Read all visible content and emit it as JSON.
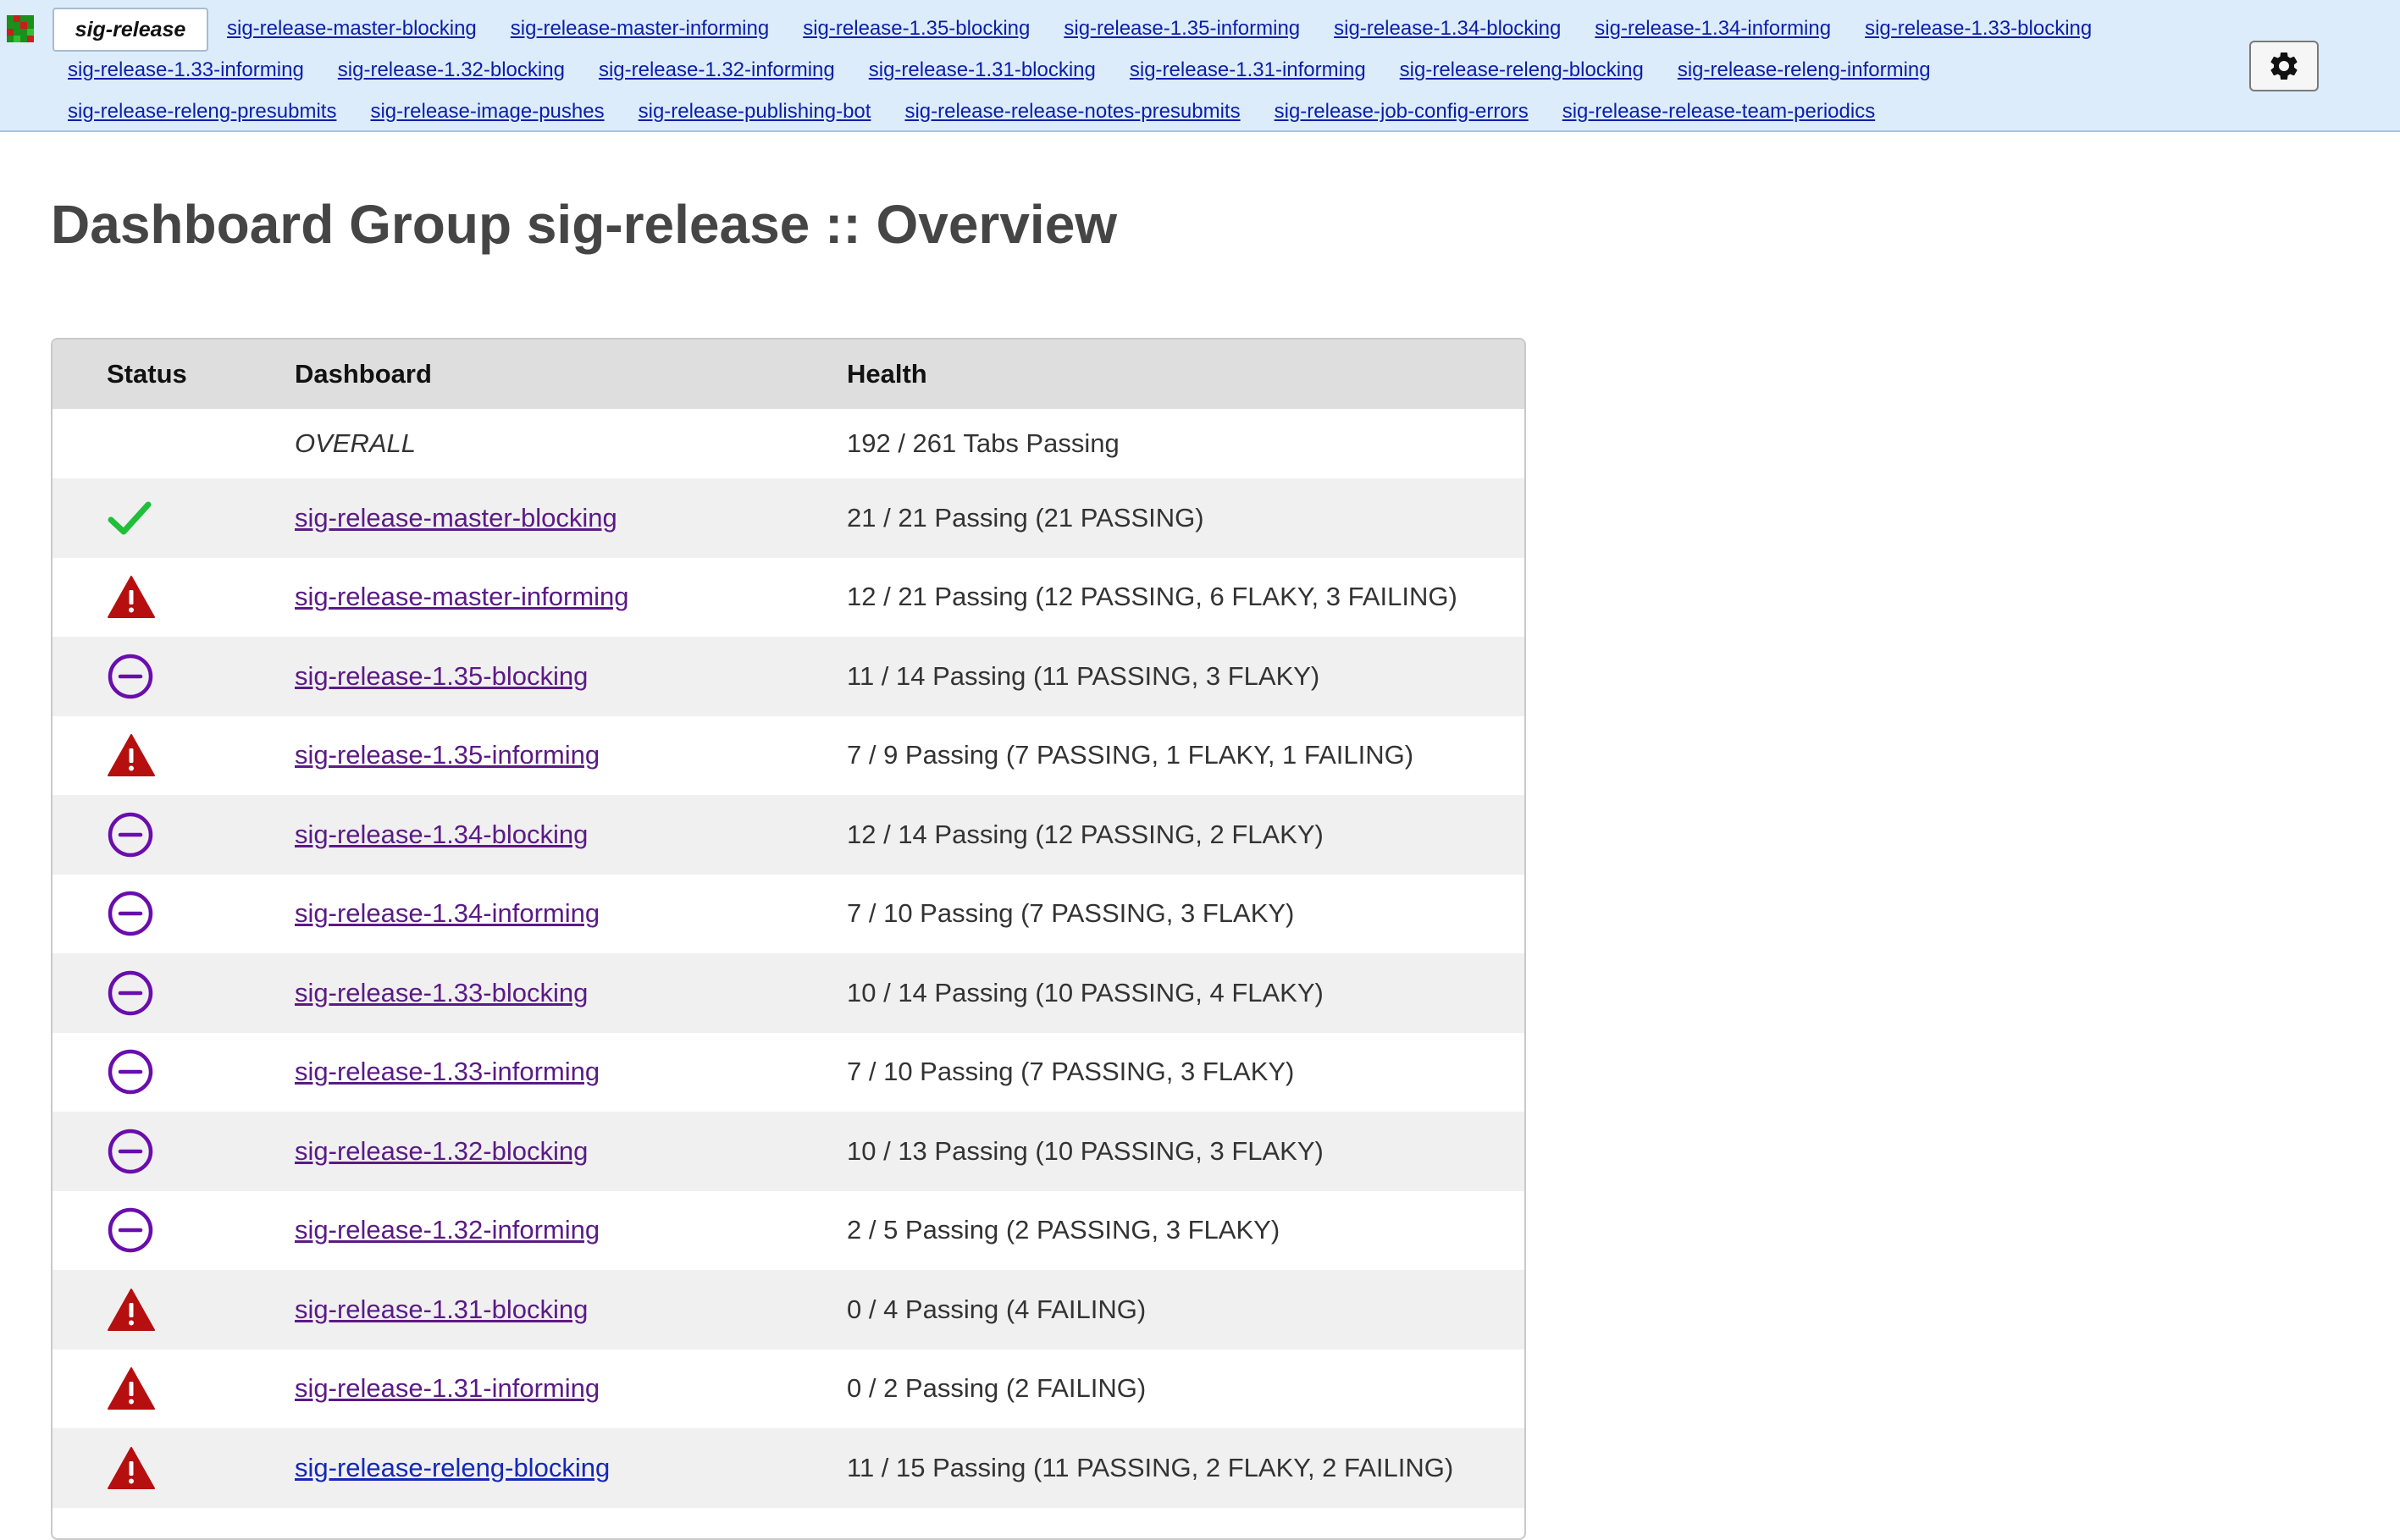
{
  "nav": {
    "current": "sig-release",
    "row1": [
      "sig-release-master-blocking",
      "sig-release-master-informing",
      "sig-release-1.35-blocking",
      "sig-release-1.35-informing",
      "sig-release-1.34-blocking",
      "sig-release-1.34-informing",
      "sig-release-1.33-blocking"
    ],
    "row2": [
      "sig-release-1.33-informing",
      "sig-release-1.32-blocking",
      "sig-release-1.32-informing",
      "sig-release-1.31-blocking",
      "sig-release-1.31-informing",
      "sig-release-releng-blocking",
      "sig-release-releng-informing"
    ],
    "row3": [
      "sig-release-releng-presubmits",
      "sig-release-image-pushes",
      "sig-release-publishing-bot",
      "sig-release-release-notes-presubmits",
      "sig-release-job-config-errors",
      "sig-release-release-team-periodics"
    ]
  },
  "page": {
    "title": "Dashboard Group sig-release :: Overview"
  },
  "table": {
    "headers": {
      "status": "Status",
      "dashboard": "Dashboard",
      "health": "Health"
    },
    "overall": {
      "label": "OVERALL",
      "health": "192 / 261 Tabs Passing"
    },
    "rows": [
      {
        "status": "passing",
        "dashboard": "sig-release-master-blocking",
        "health": "21 / 21 Passing (21 PASSING)"
      },
      {
        "status": "failing",
        "dashboard": "sig-release-master-informing",
        "health": "12 / 21 Passing (12 PASSING, 6 FLAKY, 3 FAILING)"
      },
      {
        "status": "flaky",
        "dashboard": "sig-release-1.35-blocking",
        "health": "11 / 14 Passing (11 PASSING, 3 FLAKY)"
      },
      {
        "status": "failing",
        "dashboard": "sig-release-1.35-informing",
        "health": "7 / 9 Passing (7 PASSING, 1 FLAKY, 1 FAILING)"
      },
      {
        "status": "flaky",
        "dashboard": "sig-release-1.34-blocking",
        "health": "12 / 14 Passing (12 PASSING, 2 FLAKY)"
      },
      {
        "status": "flaky",
        "dashboard": "sig-release-1.34-informing",
        "health": "7 / 10 Passing (7 PASSING, 3 FLAKY)"
      },
      {
        "status": "flaky",
        "dashboard": "sig-release-1.33-blocking",
        "health": "10 / 14 Passing (10 PASSING, 4 FLAKY)"
      },
      {
        "status": "flaky",
        "dashboard": "sig-release-1.33-informing",
        "health": "7 / 10 Passing (7 PASSING, 3 FLAKY)"
      },
      {
        "status": "flaky",
        "dashboard": "sig-release-1.32-blocking",
        "health": "10 / 13 Passing (10 PASSING, 3 FLAKY)"
      },
      {
        "status": "flaky",
        "dashboard": "sig-release-1.32-informing",
        "health": "2 / 5 Passing (2 PASSING, 3 FLAKY)"
      },
      {
        "status": "failing",
        "dashboard": "sig-release-1.31-blocking",
        "health": "0 / 4 Passing (4 FAILING)"
      },
      {
        "status": "failing",
        "dashboard": "sig-release-1.31-informing",
        "health": "0 / 2 Passing (2 FAILING)"
      },
      {
        "status": "failing",
        "dashboard": "sig-release-releng-blocking",
        "health": "11 / 15 Passing (11 PASSING, 2 FLAKY, 2 FAILING)",
        "link_state": "unvisited"
      }
    ]
  },
  "icons": {
    "logo": "testgrid-logo-icon",
    "settings": "gear-icon",
    "passing": "checkmark-icon",
    "failing": "warning-triangle-icon",
    "flaky": "minus-circle-icon"
  },
  "colors": {
    "nav_bg": "#dcecfa",
    "passing": "#1fbf3a",
    "failing": "#b50f0f",
    "flaky": "#6a0dad",
    "visited_link": "#5b1a86",
    "link": "#1328b8"
  }
}
